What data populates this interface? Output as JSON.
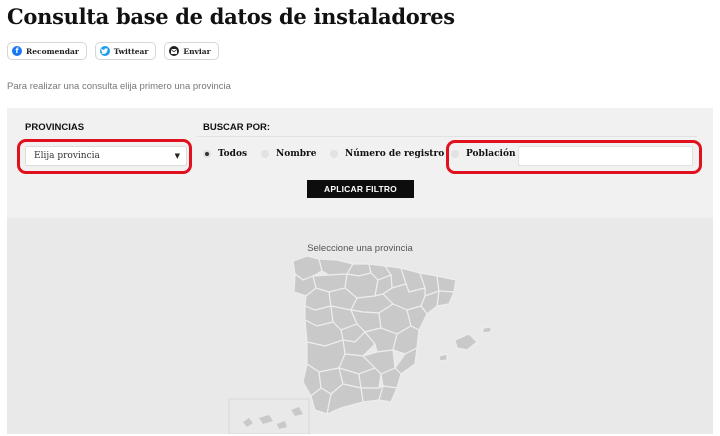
{
  "page": {
    "title": "Consulta base de datos de instaladores",
    "intro": "Para realizar una consulta elija primero una provincia"
  },
  "share": {
    "facebook": {
      "label": "Recomendar",
      "icon": "facebook-icon",
      "color": "#1877f2"
    },
    "twitter": {
      "label": "Twittear",
      "icon": "twitter-icon",
      "color": "#1d9bf0"
    },
    "email": {
      "label": "Enviar",
      "icon": "email-icon",
      "color": "#222222"
    }
  },
  "filter": {
    "provinces_label": "PROVINCIAS",
    "province_select": {
      "value": "Elija provincia"
    },
    "search_by_label": "BUSCAR POR:",
    "options": [
      {
        "label": "Todos",
        "checked": true
      },
      {
        "label": "Nombre",
        "checked": false
      },
      {
        "label": "Número de registro",
        "checked": false
      },
      {
        "label": "Población",
        "checked": false
      }
    ],
    "poblacion_input": {
      "value": ""
    },
    "apply_label": "APLICAR FILTRO",
    "highlight_color": "#e0101e"
  },
  "map": {
    "caption": "Seleccione una provincia",
    "province_fill": "#c9c9c9",
    "province_border": "#ededed"
  }
}
